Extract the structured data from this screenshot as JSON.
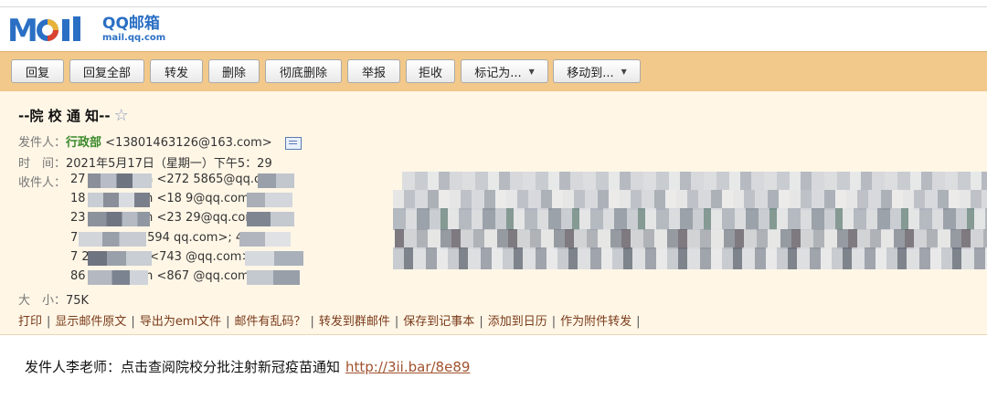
{
  "brand": {
    "logo_text": "Mail",
    "cn": "QQ邮箱",
    "url": "mail.qq.com"
  },
  "toolbar": {
    "buttons": [
      "回复",
      "回复全部",
      "转发",
      "删除",
      "彻底删除",
      "举报",
      "拒收"
    ],
    "dropdowns": [
      "标记为...",
      "移动到..."
    ]
  },
  "email": {
    "subject": "--院 校 通 知--",
    "from_label": "发件人：",
    "from_name": "行政部",
    "from_addr": "<13801463126@163.com>",
    "time_label": "时　间：",
    "time_value": "2021年5月17日（星期一）下午5：29",
    "to_label": "收件人：",
    "recipients": [
      "27      5@qq.com <272   5865@qq.com>;",
      "18        9@qq.com <18         9@qq.com>;  2",
      "23        9@qq.com <23         29@qq.com>;  7",
      "7         qq.com <7594       qq.com>;  4557",
      "7         2@qq.com <743         @qq.com>;  82",
      "86        9@qq.com <867         @qq.com>"
    ],
    "size_label": "大　小：",
    "size_value": "75K"
  },
  "links": [
    "打印",
    "显示邮件原文",
    "导出为eml文件",
    "邮件有乱码？",
    "转发到群邮件",
    "保存到记事本",
    "添加到日历",
    "作为附件转发"
  ],
  "body": {
    "text": "发件人李老师：点击查阅院校分批注射新冠疫苗通知",
    "link": "http://3ii.bar/8e89"
  },
  "colors": {
    "toolbar_bg": "#f2c98a",
    "meta_bg": "#fff6e6",
    "sender_green": "#3a8a2a",
    "link_brown": "#7a3b1a"
  }
}
